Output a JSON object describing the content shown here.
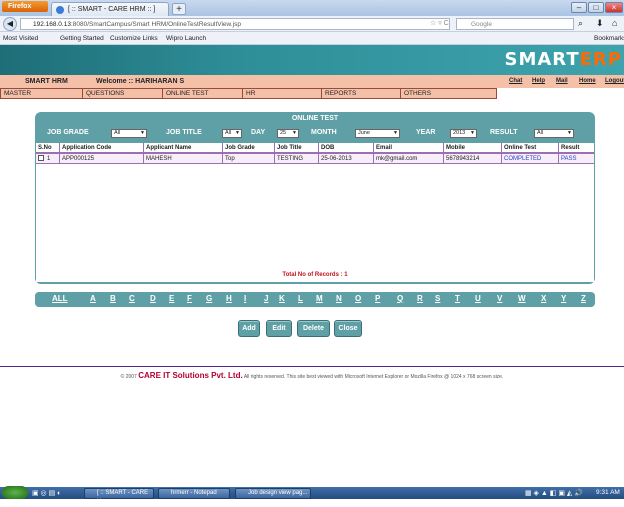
{
  "browser": {
    "app_button": "Firefox",
    "tab_title": "[ :: SMART - CARE HRM :: ]",
    "new_tab": "+",
    "url_host": "192.168.0.13",
    "url_path": ":8080/SmartCampus/Smart HRM/OnlineTestResultView.jsp",
    "search_placeholder": "Google",
    "bookmarks": [
      "Most Visited",
      "Getting Started",
      "Customize Links",
      "Wipro Launch"
    ],
    "bookmarks_right": "Bookmarks"
  },
  "app": {
    "logo_main": "SMART",
    "logo_accent": "ERP",
    "name": "SMART HRM",
    "welcome": "Welcome :: HARIHARAN S",
    "links": [
      "Chat",
      "Help",
      "Mail",
      "Home",
      "Logout"
    ],
    "menu": [
      "MASTER",
      "QUESTIONS",
      "ONLINE TEST",
      "HR",
      "REPORTS",
      "OTHERS"
    ]
  },
  "panel": {
    "title": "ONLINE TEST",
    "filters": {
      "job_grade_label": "JOB GRADE",
      "job_grade_value": "All",
      "job_title_label": "JOB TITLE",
      "job_title_value": "All",
      "day_label": "DAY",
      "day_value": "25",
      "month_label": "MONTH",
      "month_value": "June",
      "year_label": "YEAR",
      "year_value": "2013",
      "result_label": "RESULT",
      "result_value": "All"
    },
    "columns": [
      "S.No",
      "Application Code",
      "Applicant Name",
      "Job Grade",
      "Job Title",
      "DOB",
      "Email",
      "Mobile",
      "Online Test",
      "Result"
    ],
    "rows": [
      {
        "sno": "1",
        "code": "APP000125",
        "name": "MAHESH",
        "grade": "Top",
        "title": "TESTING",
        "dob": "25-06-2013",
        "email": "mk@gmail.com",
        "mobile": "5678943214",
        "online_test": "COMPLETED",
        "result": "PASS"
      }
    ],
    "total": "Total No of Records : 1"
  },
  "alphabet": [
    "ALL",
    "A",
    "B",
    "C",
    "D",
    "E",
    "F",
    "G",
    "H",
    "I",
    "J",
    "K",
    "L",
    "M",
    "N",
    "O",
    "P",
    "Q",
    "R",
    "S",
    "T",
    "U",
    "V",
    "W",
    "X",
    "Y",
    "Z"
  ],
  "buttons": [
    "Add",
    "Edit",
    "Delete",
    "Close"
  ],
  "footer": {
    "prefix": "© 2007",
    "company": "CARE IT Solutions Pvt. Ltd.",
    "note": "All rights reserved.  This site best viewed with Microsoft Internet Explorer or Mozilla Firefox @ 1024 x 768 screen size."
  },
  "taskbar": {
    "items": [
      "[ :: SMART - CARE H...",
      "hrmerr - Notepad",
      "Job design view pag..."
    ],
    "time": "9:31 AM"
  },
  "colors": {
    "panel": "#5f9fa6",
    "menu": "#f4c0a8",
    "accent": "#ff6a00",
    "total": "#c0141c"
  }
}
